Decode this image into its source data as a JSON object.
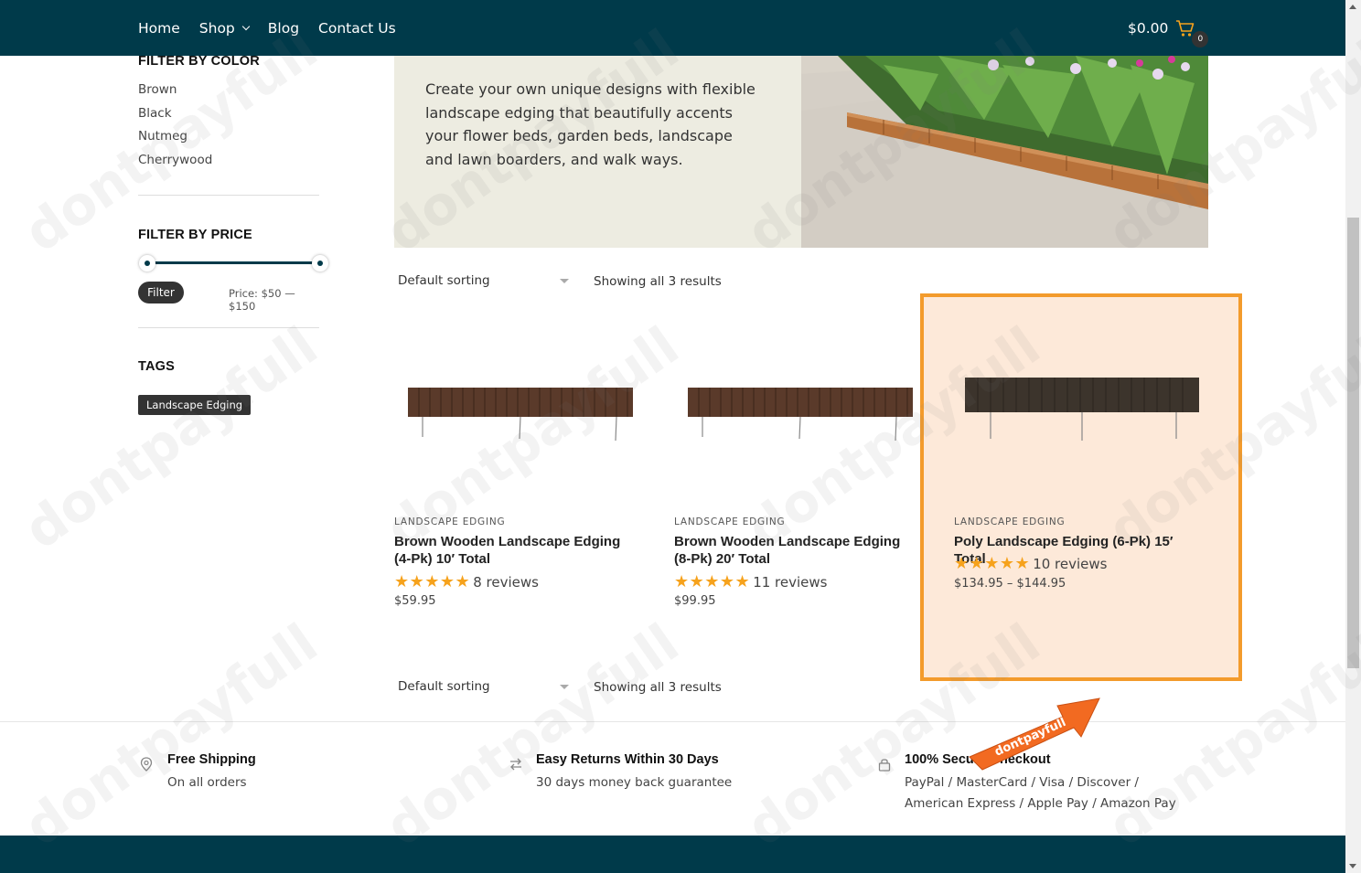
{
  "header": {
    "nav": [
      "Home",
      "Shop",
      "Blog",
      "Contact Us"
    ],
    "cart_total": "$0.00",
    "cart_count": "0"
  },
  "sidebar": {
    "color_title": "FILTER BY COLOR",
    "colors": [
      "Brown",
      "Black",
      "Nutmeg",
      "Cherrywood"
    ],
    "price_title": "FILTER BY PRICE",
    "filter_button": "Filter",
    "price_range": "Price: $50 — $150",
    "tags_title": "TAGS",
    "tag": "Landscape Edging"
  },
  "banner": {
    "text": "Create your own unique designs with flexible landscape edging that beautifully accents your flower beds, garden beds, landscape and lawn boarders, and walk ways."
  },
  "sorting": {
    "selected": "Default sorting",
    "result_count": "Showing all 3 results"
  },
  "products": [
    {
      "category": "LANDSCAPE EDGING",
      "title": "Brown Wooden Landscape Edging (4-Pk) 10′ Total",
      "stars": "★★★★★",
      "rating": 5,
      "reviews": "8 reviews",
      "price": "$59.95"
    },
    {
      "category": "LANDSCAPE EDGING",
      "title": "Brown Wooden Landscape Edging (8-Pk) 20′ Total",
      "stars": "★★★★★",
      "rating": 5,
      "reviews": "11 reviews",
      "price": "$99.95"
    },
    {
      "category": "LANDSCAPE EDGING",
      "title": "Poly Landscape Edging (6-Pk) 15′ Total",
      "stars": "★★★★★",
      "rating": 4.5,
      "reviews": "10 reviews",
      "price": "$134.95 – $144.95"
    }
  ],
  "features": [
    {
      "icon": "location-pin-icon",
      "title": "Free Shipping",
      "desc": "On all orders"
    },
    {
      "icon": "exchange-arrows-icon",
      "title": "Easy Returns Within 30 Days",
      "desc": "30 days money back guarantee"
    },
    {
      "icon": "lock-icon",
      "title": "100% Secure Checkout",
      "desc": "PayPal / MasterCard / Visa / Discover / American Express / Apple Pay / Amazon Pay"
    }
  ],
  "watermark": "dontpayfull",
  "colors": {
    "header": "#003a4a",
    "accent_star": "#f6a21c",
    "highlight_border": "#f39b2c",
    "highlight_fill": "#fde9d9",
    "badge_arrow": "#f26a21"
  }
}
